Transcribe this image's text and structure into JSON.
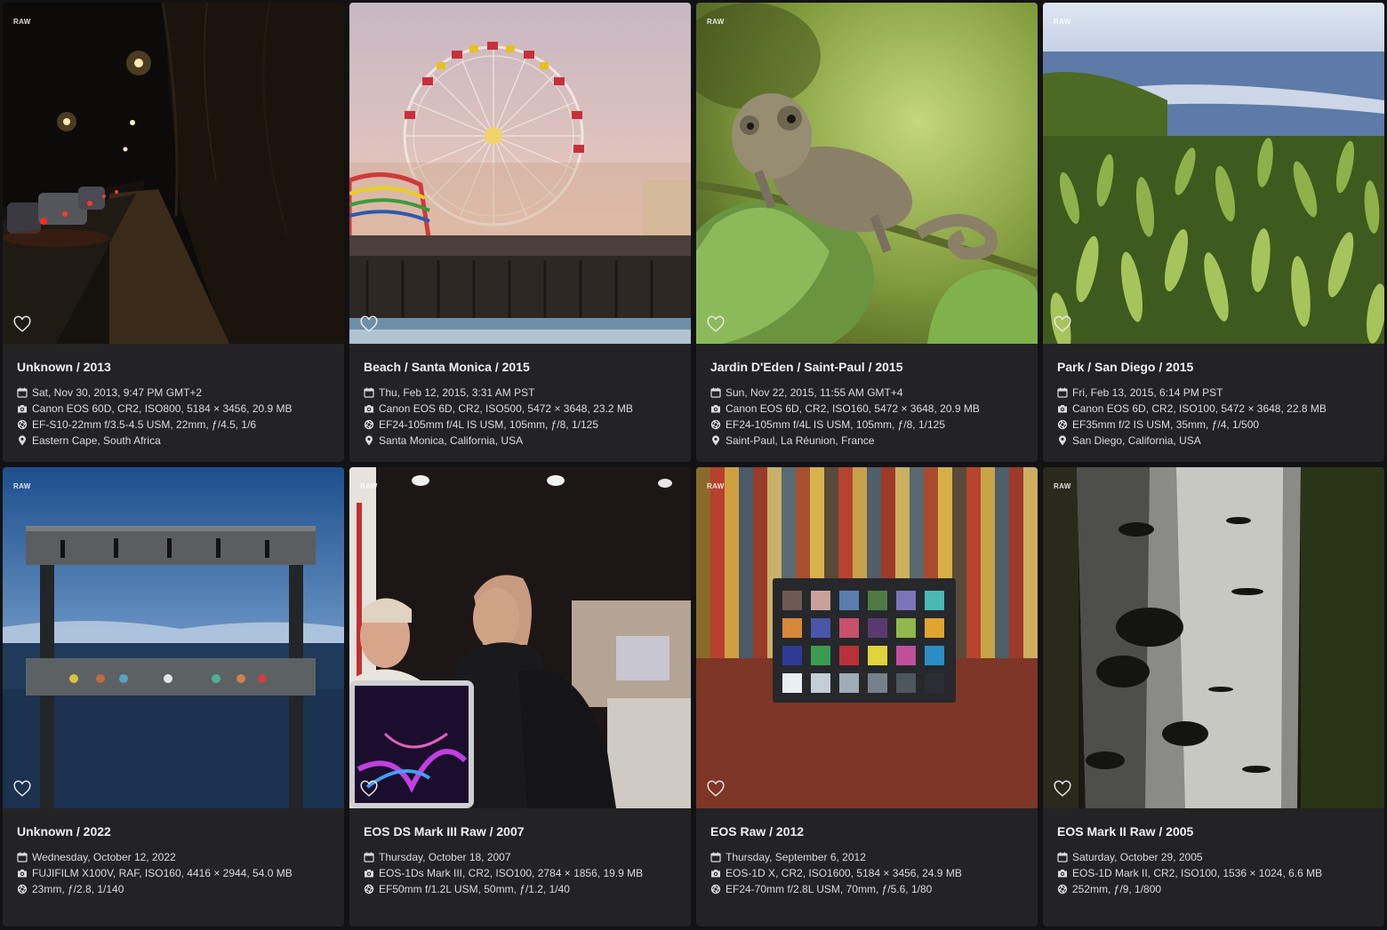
{
  "cards": [
    {
      "title": "Unknown / 2013",
      "badge": "RAW",
      "date": "Sat, Nov 30, 2013, 9:47 PM GMT+2",
      "camera": "Canon EOS 60D, CR2, ISO800, 5184 × 3456, 20.9 MB",
      "lens": "EF-S10-22mm f/3.5-4.5 USM, 22mm, ƒ/4.5, 1/6",
      "location": "Eastern Cape, South Africa"
    },
    {
      "title": "Beach / Santa Monica / 2015",
      "badge": "",
      "date": "Thu, Feb 12, 2015, 3:31 AM PST",
      "camera": "Canon EOS 6D, CR2, ISO500, 5472 × 3648, 23.2 MB",
      "lens": "EF24-105mm f/4L IS USM, 105mm, ƒ/8, 1/125",
      "location": "Santa Monica, California, USA"
    },
    {
      "title": "Jardin D'Eden / Saint-Paul / 2015",
      "badge": "RAW",
      "date": "Sun, Nov 22, 2015, 11:55 AM GMT+4",
      "camera": "Canon EOS 6D, CR2, ISO160, 5472 × 3648, 20.9 MB",
      "lens": "EF24-105mm f/4L IS USM, 105mm, ƒ/8, 1/125",
      "location": "Saint-Paul, La Réunion, France"
    },
    {
      "title": "Park / San Diego / 2015",
      "badge": "RAW",
      "date": "Fri, Feb 13, 2015, 6:14 PM PST",
      "camera": "Canon EOS 6D, CR2, ISO100, 5472 × 3648, 22.8 MB",
      "lens": "EF35mm f/2 IS USM, 35mm, ƒ/4, 1/500",
      "location": "San Diego, California, USA"
    },
    {
      "title": "Unknown / 2022",
      "badge": "RAW",
      "date": "Wednesday, October 12, 2022",
      "camera": "FUJIFILM X100V, RAF, ISO160, 4416 × 2944, 54.0 MB",
      "lens": "23mm, ƒ/2.8, 1/140",
      "location": ""
    },
    {
      "title": "EOS DS Mark III Raw / 2007",
      "badge": "RAW",
      "date": "Thursday, October 18, 2007",
      "camera": "EOS-1Ds Mark III, CR2, ISO100, 2784 × 1856, 19.9 MB",
      "lens": "EF50mm f/1.2L USM, 50mm, ƒ/1.2, 1/40",
      "location": ""
    },
    {
      "title": "EOS Raw / 2012",
      "badge": "RAW",
      "date": "Thursday, September 6, 2012",
      "camera": "EOS-1D X, CR2, ISO1600, 5184 × 3456, 24.9 MB",
      "lens": "EF24-70mm f/2.8L USM, 70mm, ƒ/5.6, 1/80",
      "location": ""
    },
    {
      "title": "EOS Mark II Raw / 2005",
      "badge": "RAW",
      "date": "Saturday, October 29, 2005",
      "camera": "EOS-1D Mark II, CR2, ISO100, 1536 × 1024, 6.6 MB",
      "lens": "252mm, ƒ/9, 1/800",
      "location": ""
    }
  ],
  "icons": {
    "date": "calendar-icon",
    "camera": "camera-icon",
    "lens": "aperture-icon",
    "location": "map-pin-icon",
    "favorite": "heart-outline-icon"
  }
}
